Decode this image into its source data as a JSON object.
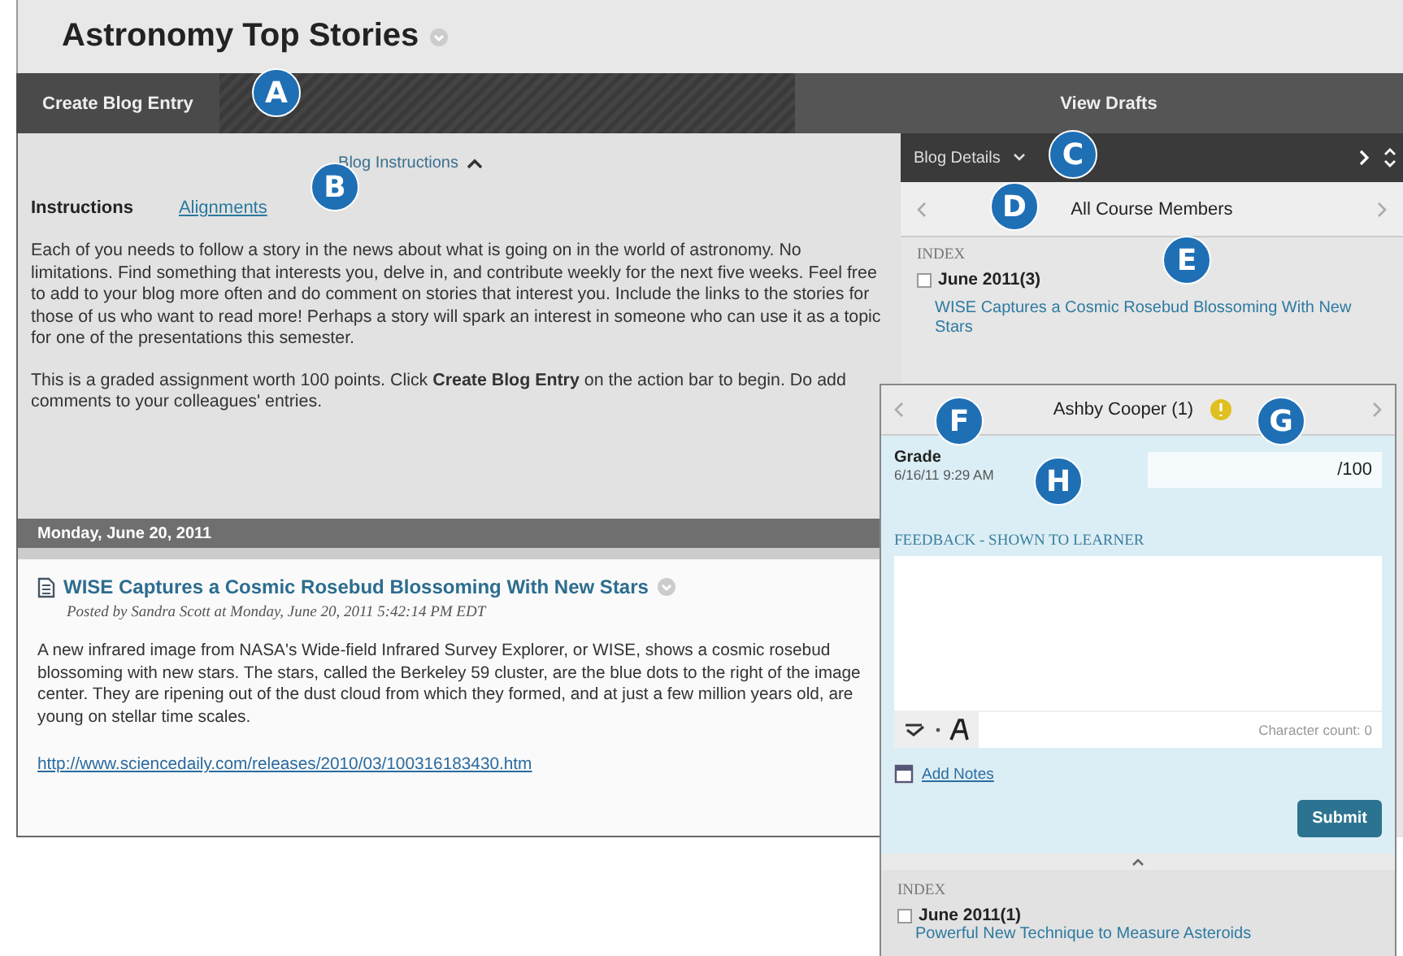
{
  "page_title": "Astronomy Top Stories",
  "action_bar": {
    "primary": "Create Blog Entry",
    "secondary": "View Drafts"
  },
  "instructions": {
    "toggle": "Blog Instructions",
    "expanded": true,
    "tabs": [
      {
        "label": "Instructions",
        "selected": true
      },
      {
        "label": "Alignments",
        "selected": false
      }
    ],
    "paragraphs": [
      "Each of you needs to follow a story in the news about what is going on in the world of astronomy. No limitations. Find something that interests you, delve in, and contribute weekly for the next five weeks. Feel free to add to your blog more often and do comment on stories that interest you. Include the links to the stories for those of us who want to read more! Perhaps a story will spark an interest in someone who can use it as a topic for one of the presentations this semester.",
      "This is a graded assignment worth 100 points. Click **Create Blog Entry** on the action bar to begin. Do add comments to your colleagues' entries."
    ]
  },
  "date_header": "Monday, June 20, 2011",
  "entry": {
    "title": "WISE Captures a Cosmic Rosebud Blossoming With New Stars",
    "byline": "Posted by  Sandra Scott  at Monday, June 20, 2011 5:42:14 PM EDT",
    "body": "A new infrared image from NASA's Wide-field Infrared Survey Explorer, or WISE, shows a cosmic rosebud blossoming with new stars. The stars, called the Berkeley 59 cluster, are the blue dots to the right of the image center. They are ripening out of the dust cloud from which they formed, and at just a few million years old, are young on stellar time scales.",
    "link": "http://www.sciencedaily.com/releases/2010/03/100316183430.htm"
  },
  "blog_details": {
    "title": "Blog Details",
    "member": "All Course Members",
    "index_label": "INDEX",
    "month": "June 2011(3)",
    "entry_link": "WISE Captures a Cosmic Rosebud Blossoming With New Stars"
  },
  "grading": {
    "student": "Ashby Cooper (1)",
    "grade_label": "Grade",
    "grade_date": "6/16/11 9:29 AM",
    "grade_suffix": "/100",
    "feedback_label": "FEEDBACK - SHOWN TO LEARNER",
    "char_count": "Character count: 0",
    "add_notes": "Add Notes",
    "submit": "Submit",
    "index_label": "INDEX",
    "month": "June 2011(1)",
    "entry_link": "Powerful New Technique to Measure Asteroids"
  },
  "callouts": [
    {
      "label": "A"
    },
    {
      "label": "B"
    },
    {
      "label": "C"
    },
    {
      "label": "D"
    },
    {
      "label": "E"
    },
    {
      "label": "F"
    },
    {
      "label": "G"
    },
    {
      "label": "H"
    }
  ]
}
